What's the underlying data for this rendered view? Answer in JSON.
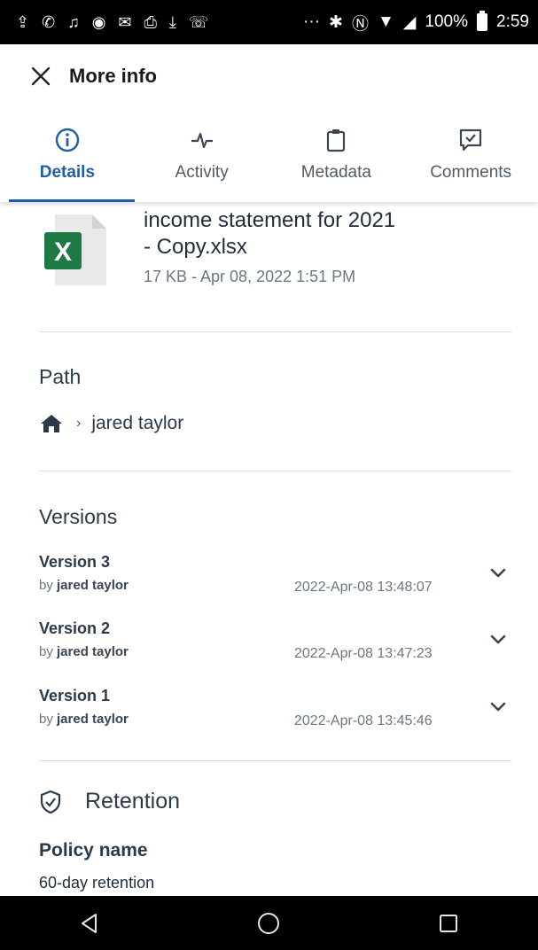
{
  "status_bar": {
    "battery": "100%",
    "time": "2:59",
    "icons": [
      "cloud-upload-icon",
      "whatsapp-icon",
      "bell-icon",
      "record-icon",
      "gmail-icon",
      "printer-icon",
      "download-icon",
      "missed-calls-icon",
      "more-icon",
      "bluetooth-icon",
      "nfc-icon",
      "wifi-icon",
      "signal-icon",
      "battery-icon"
    ]
  },
  "header": {
    "title": "More info",
    "close_icon": "close-icon"
  },
  "tabs": [
    {
      "label": "Details",
      "icon": "info-icon",
      "active": true
    },
    {
      "label": "Activity",
      "icon": "activity-icon",
      "active": false
    },
    {
      "label": "Metadata",
      "icon": "clipboard-icon",
      "active": false
    },
    {
      "label": "Comments",
      "icon": "comment-check-icon",
      "active": false
    }
  ],
  "file": {
    "name_line1": "income statement for 2021",
    "name_line2": "- Copy.xlsx",
    "meta": "17 KB - Apr 08, 2022 1:51 PM",
    "icon": "excel-file-icon",
    "icon_letter": "X"
  },
  "path": {
    "title": "Path",
    "home_icon": "home-icon",
    "separator": "›",
    "folder": "jared taylor"
  },
  "versions": {
    "title": "Versions",
    "items": [
      {
        "name": "Version 3",
        "by_prefix": "by",
        "author": "jared taylor",
        "date": "2022-Apr-08 13:48:07"
      },
      {
        "name": "Version 2",
        "by_prefix": "by",
        "author": "jared taylor",
        "date": "2022-Apr-08 13:47:23"
      },
      {
        "name": "Version 1",
        "by_prefix": "by",
        "author": "jared taylor",
        "date": "2022-Apr-08 13:45:46"
      }
    ]
  },
  "retention": {
    "title": "Retention",
    "icon": "shield-check-icon",
    "policy_label": "Policy name",
    "policy_value": "60-day retention"
  },
  "nav_bar": {
    "back": "back-icon",
    "home": "home-circle-icon",
    "recents": "recents-icon"
  },
  "colors": {
    "accent": "#1f5ea8",
    "excel_green": "#1d7a45",
    "text": "#2b3a4a",
    "muted": "#6b7782"
  }
}
